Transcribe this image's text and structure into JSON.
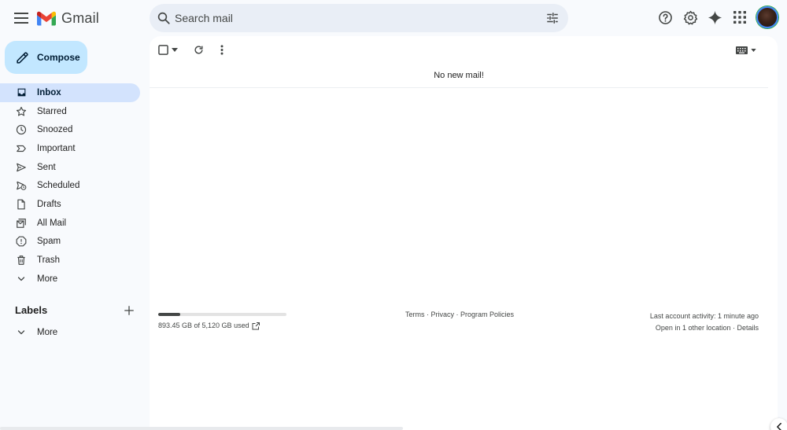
{
  "app": {
    "logo_text": "Gmail",
    "accent_color": "#c2e7ff",
    "active_nav_color": "#d3e3fd"
  },
  "search": {
    "placeholder": "Search mail",
    "value": ""
  },
  "icons": {
    "menu": "hamburger-icon",
    "search": "search-icon",
    "tune": "tune-icon",
    "support": "help-icon",
    "settings": "gear-icon",
    "gemini": "sparkle-icon",
    "apps": "apps-grid-icon"
  },
  "sidebar": {
    "compose_label": "Compose",
    "items": [
      {
        "label": "Inbox",
        "icon": "inbox-icon",
        "active": true
      },
      {
        "label": "Starred",
        "icon": "star-icon"
      },
      {
        "label": "Snoozed",
        "icon": "clock-icon"
      },
      {
        "label": "Important",
        "icon": "important-icon"
      },
      {
        "label": "Sent",
        "icon": "send-icon"
      },
      {
        "label": "Scheduled",
        "icon": "scheduled-icon"
      },
      {
        "label": "Drafts",
        "icon": "draft-icon"
      },
      {
        "label": "All Mail",
        "icon": "all-mail-icon"
      },
      {
        "label": "Spam",
        "icon": "spam-icon"
      },
      {
        "label": "Trash",
        "icon": "trash-icon"
      },
      {
        "label": "More",
        "icon": "chevron-down-icon"
      }
    ],
    "labels_heading": "Labels",
    "labels_more": "More"
  },
  "main": {
    "empty_message": "No new mail!",
    "storage_text": "893.45 GB of 5,120 GB used",
    "storage_fraction": 0.1745,
    "footer": {
      "terms": "Terms",
      "privacy": "Privacy",
      "policies": "Program Policies",
      "separator": " · "
    },
    "activity": {
      "line1": "Last account activity: 1 minute ago",
      "line2_prefix": "Open in 1 other location · ",
      "details": "Details"
    }
  }
}
